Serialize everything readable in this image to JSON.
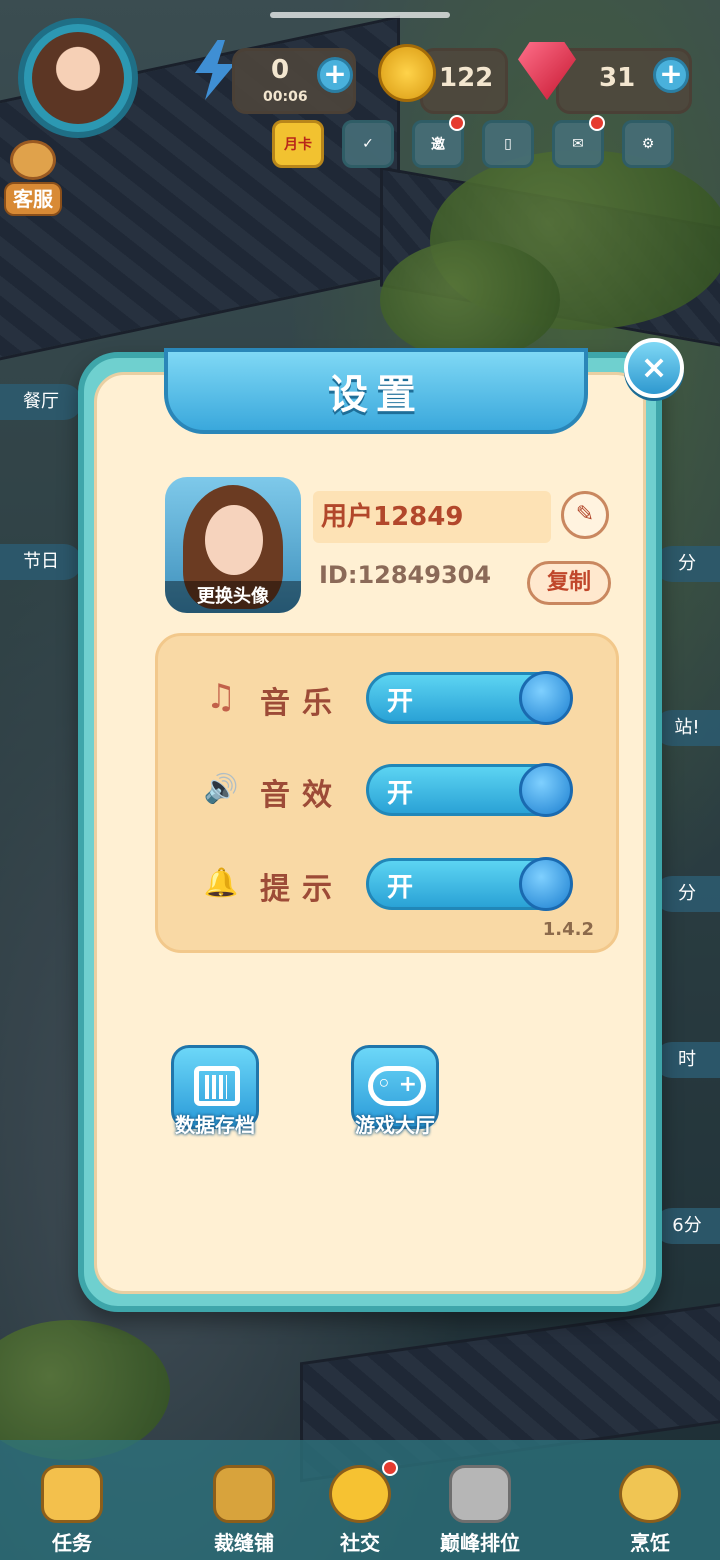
{
  "hud": {
    "energy_value": "0",
    "energy_timer": "00:06",
    "coins": "122",
    "gems": "31",
    "plus": "+",
    "customer_service": "客服",
    "icons": [
      {
        "name": "month-card-icon",
        "label": "月卡"
      },
      {
        "name": "calendar-check-icon",
        "label": ""
      },
      {
        "name": "invite-icon",
        "label": "邀"
      },
      {
        "name": "book-icon",
        "label": ""
      },
      {
        "name": "mail-icon",
        "label": ""
      },
      {
        "name": "gear-icon",
        "label": ""
      }
    ]
  },
  "side": {
    "left": [
      "餐厅",
      "节日"
    ],
    "right": [
      "分",
      "站!",
      "分",
      "时",
      "6分"
    ]
  },
  "settings": {
    "title": "设置",
    "close": "×",
    "avatar_caption": "更换头像",
    "username": "用户12849",
    "edit_icon": "✎",
    "user_id": "ID:12849304",
    "copy_label": "复制",
    "toggles": [
      {
        "icon": "music-note-icon",
        "glyph": "♫",
        "label": "音乐",
        "state": "开",
        "on": true
      },
      {
        "icon": "speaker-icon",
        "glyph": "🔊",
        "label": "音效",
        "state": "开",
        "on": true
      },
      {
        "icon": "bell-icon",
        "glyph": "🔔",
        "label": "提示",
        "state": "开",
        "on": true
      }
    ],
    "version": "1.4.2",
    "actions": [
      {
        "name": "data-archive",
        "label": "数据存档"
      },
      {
        "name": "game-hall",
        "label": "游戏大厅"
      }
    ]
  },
  "bottom_nav": [
    {
      "name": "tasks",
      "label": "任务"
    },
    {
      "name": "tailor-shop",
      "label": "裁缝铺"
    },
    {
      "name": "social",
      "label": "社交"
    },
    {
      "name": "peak-ranking",
      "label": "巅峰排位"
    },
    {
      "name": "cooking",
      "label": "烹饪"
    }
  ],
  "colors": {
    "modal_border": "#3ea6aa",
    "modal_bg": "#fff0d3",
    "switch_on": "#2aa2d6",
    "text_brown": "#9d4b37"
  }
}
